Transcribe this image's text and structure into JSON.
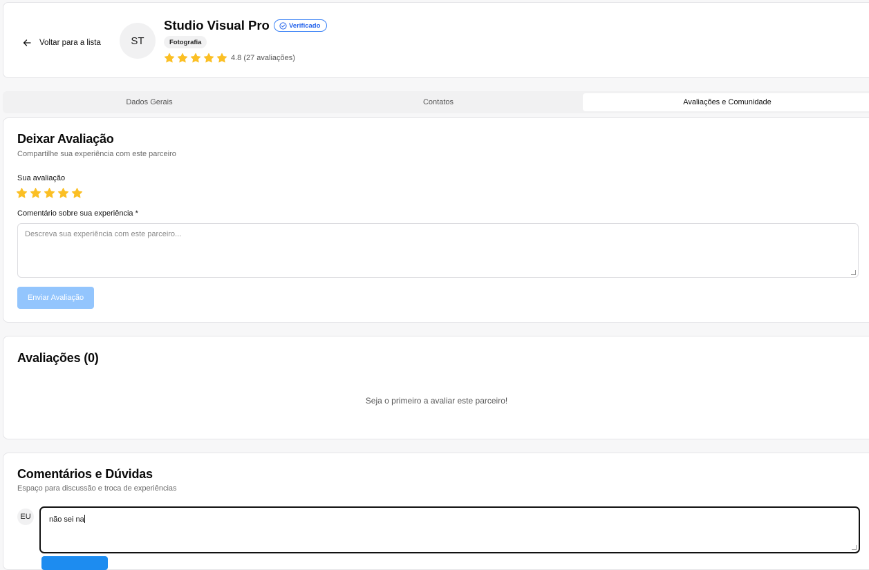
{
  "header": {
    "back_label": "Voltar para a lista",
    "avatar_initials": "ST",
    "partner_name": "Studio Visual Pro",
    "verified_label": "Verificado",
    "category": "Fotografia",
    "rating_value": 4.8,
    "rating_text": "4.8 (27 avaliações)",
    "stars_filled": 5
  },
  "tabs": [
    {
      "label": "Dados Gerais",
      "active": false
    },
    {
      "label": "Contatos",
      "active": false
    },
    {
      "label": "Avaliações e Comunidade",
      "active": true
    }
  ],
  "review_form": {
    "title": "Deixar Avaliação",
    "subtitle": "Compartilhe sua experiência com este parceiro",
    "rating_label": "Sua avaliação",
    "stars_selected": 5,
    "comment_label": "Comentário sobre sua experiência *",
    "comment_placeholder": "Descreva sua experiência com este parceiro...",
    "comment_value": "",
    "submit_label": "Enviar Avaliação"
  },
  "reviews": {
    "title": "Avaliações (0)",
    "empty_message": "Seja o primeiro a avaliar este parceiro!"
  },
  "comments": {
    "title": "Comentários e Dúvidas",
    "subtitle": "Espaço para discussão e troca de experiências",
    "user_initials": "EU",
    "draft_value": "não sei na"
  },
  "colors": {
    "star": "#fbbf24",
    "accent": "#2563eb",
    "submit_disabled": "#93c5fd",
    "comment_button": "#1d8cf0"
  }
}
